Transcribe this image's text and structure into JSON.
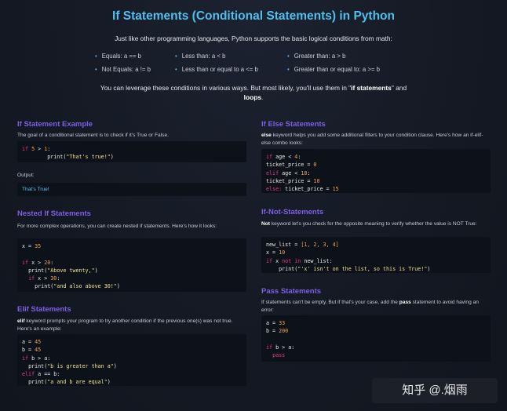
{
  "title": "If Statements (Conditional Statements) in Python",
  "intro": "Just like other programming languages, Python supports the basic logical conditions from math:",
  "conditions": [
    "Equals: a == b",
    "Less than: a < b",
    "Greater than: a > b",
    "Not Equals: a != b",
    "Less than or equal to a <= b",
    "Greater than or equal to: a >= b"
  ],
  "leverage": {
    "text": "You can leverage these conditions in various ways. But most likely, you'll use them in \"",
    "b1": "if statements",
    "mid": "\" and ",
    "b2": "loops",
    "end": "."
  },
  "if_example": {
    "heading": "If Statement Example",
    "desc": "The goal of a conditional statement is to check if it's True or False.",
    "output_label": "Output:",
    "output": "That's True!"
  },
  "nested": {
    "heading": "Nested If Statements",
    "desc": "For more complex operations, you can create nested if statements. Here's how it looks:"
  },
  "elif": {
    "heading": "Elif Statements",
    "kw": "elif",
    "desc": " keyword prompts your program to try another condition if the previous one(s) was not true. Here's an example:"
  },
  "ifelse": {
    "heading": "If Else Statements",
    "kw": "else",
    "desc": " keyword helps you add some additional filters to your condition clause. Here's how an if-elif-else combo looks:"
  },
  "ifnot": {
    "heading": "If-Not-Statements",
    "kw": "Not",
    "desc": " keyword let's you check for the opposite meaning to verify whether the value is NOT True:"
  },
  "pass": {
    "heading": "Pass Statements",
    "desc1": "If statements can't be empty. But if that's your case, add the ",
    "kw": "pass",
    "desc2": " statement to avoid having an error:"
  },
  "code": {
    "k_if": "if",
    "k_elif": "elif",
    "k_else": "else:",
    "k_print": "print",
    "k_not": "not",
    "k_in": "in",
    "k_pass": "pass",
    "if_ex_a": "5",
    "if_ex_b": "1",
    "if_ex_str": "\"That's true!\"",
    "n_var": "x",
    "n_val": "35",
    "n_c1": "20",
    "n_s1": "\"Above twenty,\"",
    "n_c2": "30",
    "n_s2": "\"and also above 30!\"",
    "e_a": "45",
    "e_b": "45",
    "e_s1": "\"b is greater than a\"",
    "e_s2": "\"a and b are equal\"",
    "ie_var": "age",
    "ie_c1": "4",
    "ie_v1": "0",
    "ie_c2": "18",
    "ie_v2": "10",
    "ie_v3": "15",
    "ie_tp": "ticket_price",
    "nl_list": "[1, 2, 3, 4]",
    "nl_x": "10",
    "nl_str": "\"'x' isn't on the list, so this is True!\"",
    "nl_name": "new_list",
    "p_a": "33",
    "p_b": "200"
  },
  "watermark": "知乎 @.烟雨"
}
